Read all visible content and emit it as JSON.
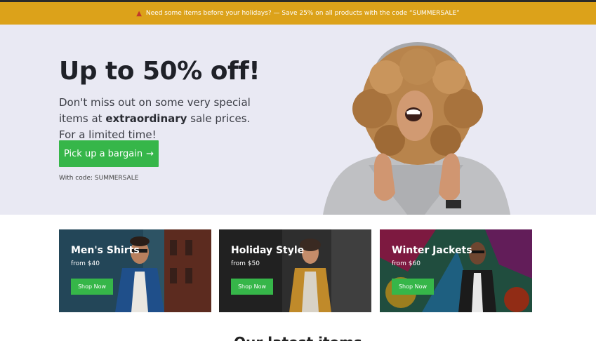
{
  "promo": {
    "icon": "fire-icon",
    "text": "Need some items before your holidays? — Save 25% on all products with the code “SUMMERSALE”"
  },
  "hero": {
    "title": "Up to 50% off!",
    "text_before": "Don't miss out on some very special items at ",
    "text_bold": "extraordinary",
    "text_after": " sale prices. For a limited time!",
    "cta_label": "Pick up a bargain",
    "cta_arrow": "→",
    "code_note": "With code: SUMMERSALE"
  },
  "categories": [
    {
      "title": "Men's Shirts",
      "price": "from $40",
      "button": "Shop Now"
    },
    {
      "title": "Holiday Style",
      "price": "from $50",
      "button": "Shop Now"
    },
    {
      "title": "Winter Jackets",
      "price": "from $60",
      "button": "Shop Now"
    }
  ],
  "section": {
    "heading": "Our latest items"
  },
  "colors": {
    "promo_bar": "#dca21a",
    "hero_bg": "#e9e9f3",
    "accent_green": "#36b649"
  }
}
